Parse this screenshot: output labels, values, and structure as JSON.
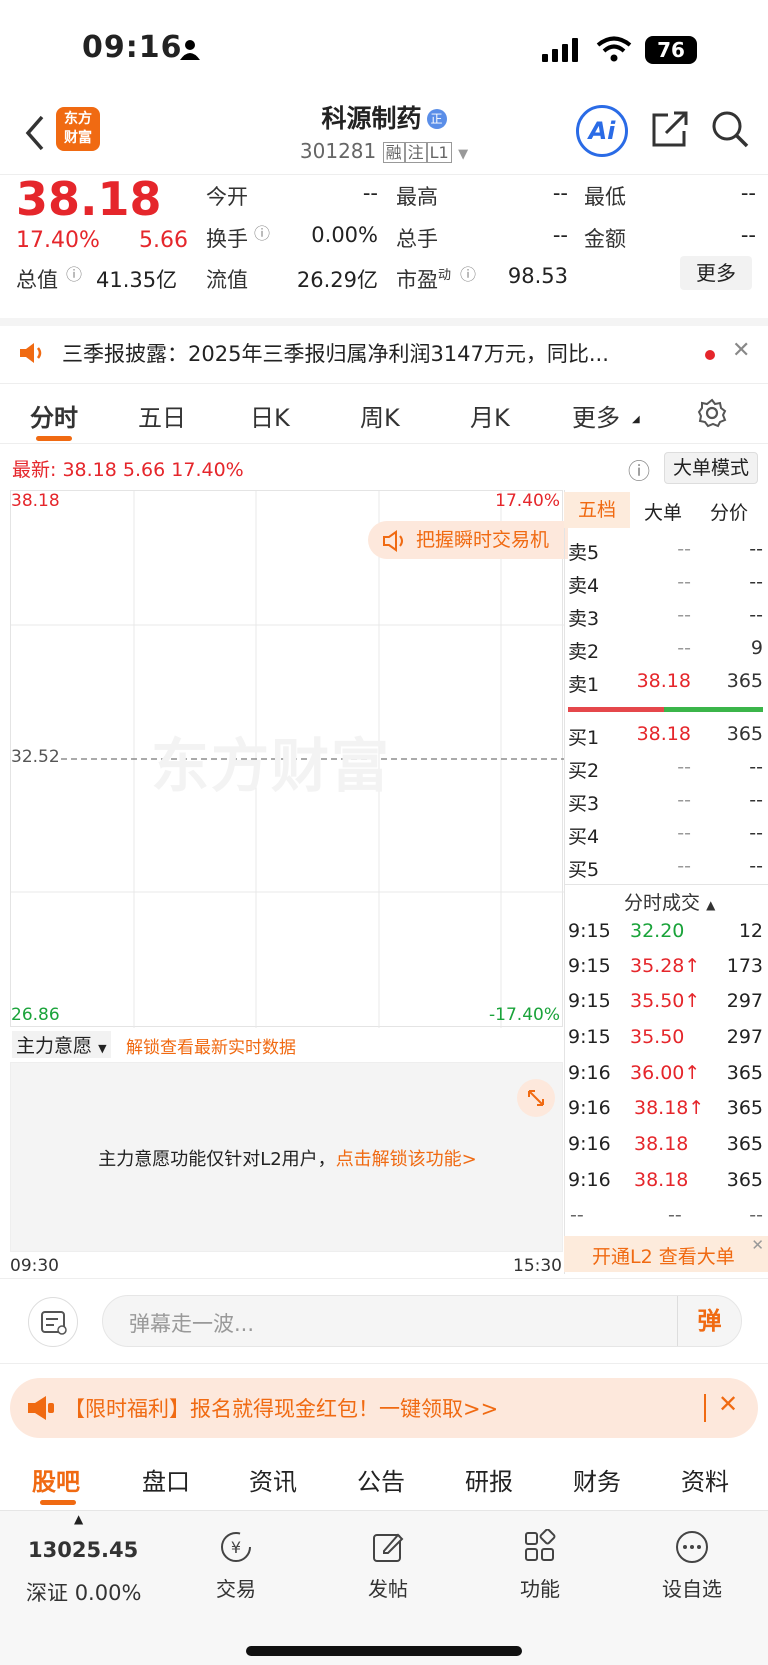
{
  "status": {
    "time": "09:16",
    "battery": "76"
  },
  "header": {
    "logo_line1": "东方",
    "logo_line2": "财富",
    "name": "科源制药",
    "name_badge": "正",
    "code": "301281",
    "tags": [
      "融",
      "注",
      "L1"
    ],
    "ai_label": "Ai"
  },
  "quote": {
    "price": "38.18",
    "pct": "17.40%",
    "change": "5.66",
    "fields": [
      {
        "label": "今开",
        "value": "--"
      },
      {
        "label": "最高",
        "value": "--"
      },
      {
        "label": "最低",
        "value": "--"
      },
      {
        "label": "换手",
        "value": "0.00%"
      },
      {
        "label": "总手",
        "value": "--"
      },
      {
        "label": "金额",
        "value": "--"
      },
      {
        "label": "总值",
        "value": "41.35亿"
      },
      {
        "label": "流值",
        "value": "26.29亿"
      },
      {
        "label": "市盈",
        "label_sup": "动",
        "value": "98.53"
      }
    ],
    "more_button": "更多"
  },
  "notice": {
    "text": "三季报披露：2025年三季报归属净利润3147万元，同比..."
  },
  "tabs": [
    "分时",
    "五日",
    "日K",
    "周K",
    "月K",
    "更多"
  ],
  "chart": {
    "latest_label": "最新:",
    "latest_price": "38.18",
    "latest_change": "5.66",
    "latest_pct": "17.40%",
    "mode_button": "大单模式",
    "y_top": "38.18",
    "y_mid": "32.52",
    "y_bot": "26.86",
    "pct_top": "17.40%",
    "pct_bot": "-17.40%",
    "promo": "把握瞬时交易机",
    "watermark": "东方财富",
    "time_start": "09:30",
    "time_end": "15:30"
  },
  "mainforce": {
    "select": "主力意愿",
    "unlock_hint": "解锁查看最新实时数据",
    "msg": "主力意愿功能仅针对L2用户，",
    "link": "点击解锁该功能>"
  },
  "orderbook": {
    "tabs": [
      "五档",
      "大单",
      "分价"
    ],
    "asks": [
      {
        "label": "卖5",
        "price": "--",
        "vol": "--"
      },
      {
        "label": "卖4",
        "price": "--",
        "vol": "--"
      },
      {
        "label": "卖3",
        "price": "--",
        "vol": "--"
      },
      {
        "label": "卖2",
        "price": "--",
        "vol": "9"
      },
      {
        "label": "卖1",
        "price": "38.18",
        "vol": "365"
      }
    ],
    "bids": [
      {
        "label": "买1",
        "price": "38.18",
        "vol": "365"
      },
      {
        "label": "买2",
        "price": "--",
        "vol": "--"
      },
      {
        "label": "买3",
        "price": "--",
        "vol": "--"
      },
      {
        "label": "买4",
        "price": "--",
        "vol": "--"
      },
      {
        "label": "买5",
        "price": "--",
        "vol": "--"
      }
    ],
    "trades_title": "分时成交",
    "trades": [
      {
        "time": "9:15",
        "price": "32.20",
        "vol": "12",
        "color": "green"
      },
      {
        "time": "9:15",
        "price": "35.28↑",
        "vol": "173",
        "color": "red"
      },
      {
        "time": "9:15",
        "price": "35.50↑",
        "vol": "297",
        "color": "red"
      },
      {
        "time": "9:15",
        "price": "35.50",
        "vol": "297",
        "color": "red"
      },
      {
        "time": "9:16",
        "price": "36.00↑",
        "vol": "365",
        "color": "red"
      },
      {
        "time": "9:16",
        "price": "38.18↑",
        "vol": "365",
        "color": "red"
      },
      {
        "time": "9:16",
        "price": "38.18",
        "vol": "365",
        "color": "red"
      },
      {
        "time": "9:16",
        "price": "38.18",
        "vol": "365",
        "color": "red"
      },
      {
        "time": "--",
        "price": "--",
        "vol": "--",
        "color": "gray"
      }
    ],
    "l2_banner": "开通L2 查看大单"
  },
  "danmu": {
    "placeholder": "弹幕走一波...",
    "send": "弹"
  },
  "promo_bar": {
    "text": "【限时福利】报名就得现金红包！一键领取>>"
  },
  "bottom_tabs": [
    "股吧",
    "盘口",
    "资讯",
    "公告",
    "研报",
    "财务",
    "资料"
  ],
  "index": {
    "value": "13025.45",
    "name": "深证",
    "pct": "0.00%"
  },
  "nav": [
    {
      "label": "交易",
      "icon": "trade-icon"
    },
    {
      "label": "发帖",
      "icon": "post-icon"
    },
    {
      "label": "功能",
      "icon": "grid-icon"
    },
    {
      "label": "设自选",
      "icon": "more-icon"
    }
  ],
  "colors": {
    "up": "#e5262b",
    "down": "#1aa33a",
    "accent": "#f06a12"
  }
}
